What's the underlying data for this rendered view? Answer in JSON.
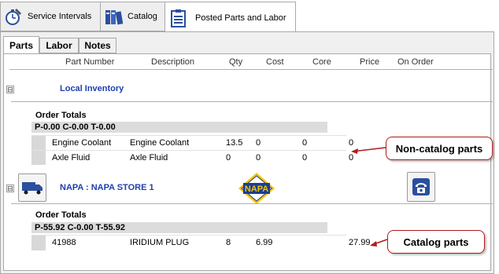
{
  "top_tabs": [
    {
      "label": "Service Intervals",
      "icon": "stopwatch-wrench-icon"
    },
    {
      "label": "Catalog",
      "icon": "binders-icon"
    },
    {
      "label": "Posted Parts and Labor",
      "icon": "clipboard-list-icon"
    }
  ],
  "sub_tabs": [
    "Parts",
    "Labor",
    "Notes"
  ],
  "columns": [
    "Part Number",
    "Description",
    "Qty",
    "Cost",
    "Core",
    "Price",
    "On Order"
  ],
  "groups": [
    {
      "vendor": "Local Inventory",
      "expander": "⊟",
      "totals_label": "Order Totals",
      "totals": "P-0.00 C-0.00 T-0.00",
      "rows": [
        {
          "part": "Engine Coolant",
          "desc": "Engine Coolant",
          "qty": "13.5",
          "cost": "0",
          "core": "0",
          "price": "0"
        },
        {
          "part": "Axle Fluid",
          "desc": "Axle Fluid",
          "qty": "0",
          "cost": "0",
          "core": "0",
          "price": "0"
        }
      ]
    },
    {
      "vendor": "NAPA : NAPA STORE 1",
      "expander": "⊟",
      "logo_text": "NAPA",
      "totals_label": "Order Totals",
      "totals": "P-55.92 C-0.00 T-55.92",
      "rows": [
        {
          "part": "41988",
          "desc": "IRIDIUM PLUG",
          "qty": "8",
          "cost": "6.99",
          "core": "",
          "price": "27.99"
        }
      ]
    }
  ],
  "callouts": {
    "non_catalog": "Non-catalog parts",
    "catalog": "Catalog parts"
  },
  "colors": {
    "vendor_text": "#1f3fb0",
    "callout_border": "#b01c1c",
    "napa_yellow": "#f5c400",
    "napa_blue": "#1b3e8f"
  }
}
